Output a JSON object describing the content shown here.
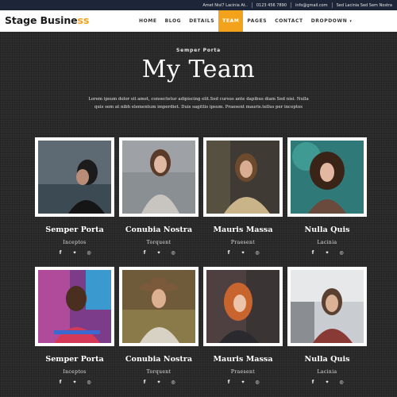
{
  "topbar": {
    "address": "Amet Nisl7 Lacinia At..",
    "phone": "0123 456 7890",
    "email": "info@gmail.com",
    "location": "Sed Lacinia Sed Sem Nostra"
  },
  "brand": {
    "name_main": "Stage Busine",
    "name_accent": "ss"
  },
  "nav": {
    "items": [
      "HOME",
      "BLOG",
      "DETAILS",
      "TEAM",
      "PAGES",
      "CONTACT",
      "DROPDOWN"
    ],
    "active": "TEAM"
  },
  "hero": {
    "subtitle": "Semper Porta",
    "title": "My Team",
    "description": "Lorem ipsum dolor sit amet, consectetur adipiscing elit.Sed cursus ante dapibus diam Sed nisi. Nulla quis sem at nibh elementum imperdiet. Duis sagittis ipsum. Praesent mauris.tellus per inceptos"
  },
  "team": [
    {
      "name": "Semper Porta",
      "role": "Inceptos"
    },
    {
      "name": "Conubia Nostra",
      "role": "Torquent"
    },
    {
      "name": "Mauris Massa",
      "role": "Praesent"
    },
    {
      "name": "Nulla Quis",
      "role": "Lacinia"
    },
    {
      "name": "Semper Porta",
      "role": "Inceptos"
    },
    {
      "name": "Conubia Nostra",
      "role": "Torquent"
    },
    {
      "name": "Mauris Massa",
      "role": "Praesent"
    },
    {
      "name": "Nulla Quis",
      "role": "Lacinia"
    }
  ],
  "socials": [
    "facebook-icon",
    "twitter-icon",
    "instagram-icon"
  ],
  "colors": {
    "accent": "#f2a31b",
    "topbar": "#1d2538",
    "background": "#2a2a2a"
  }
}
